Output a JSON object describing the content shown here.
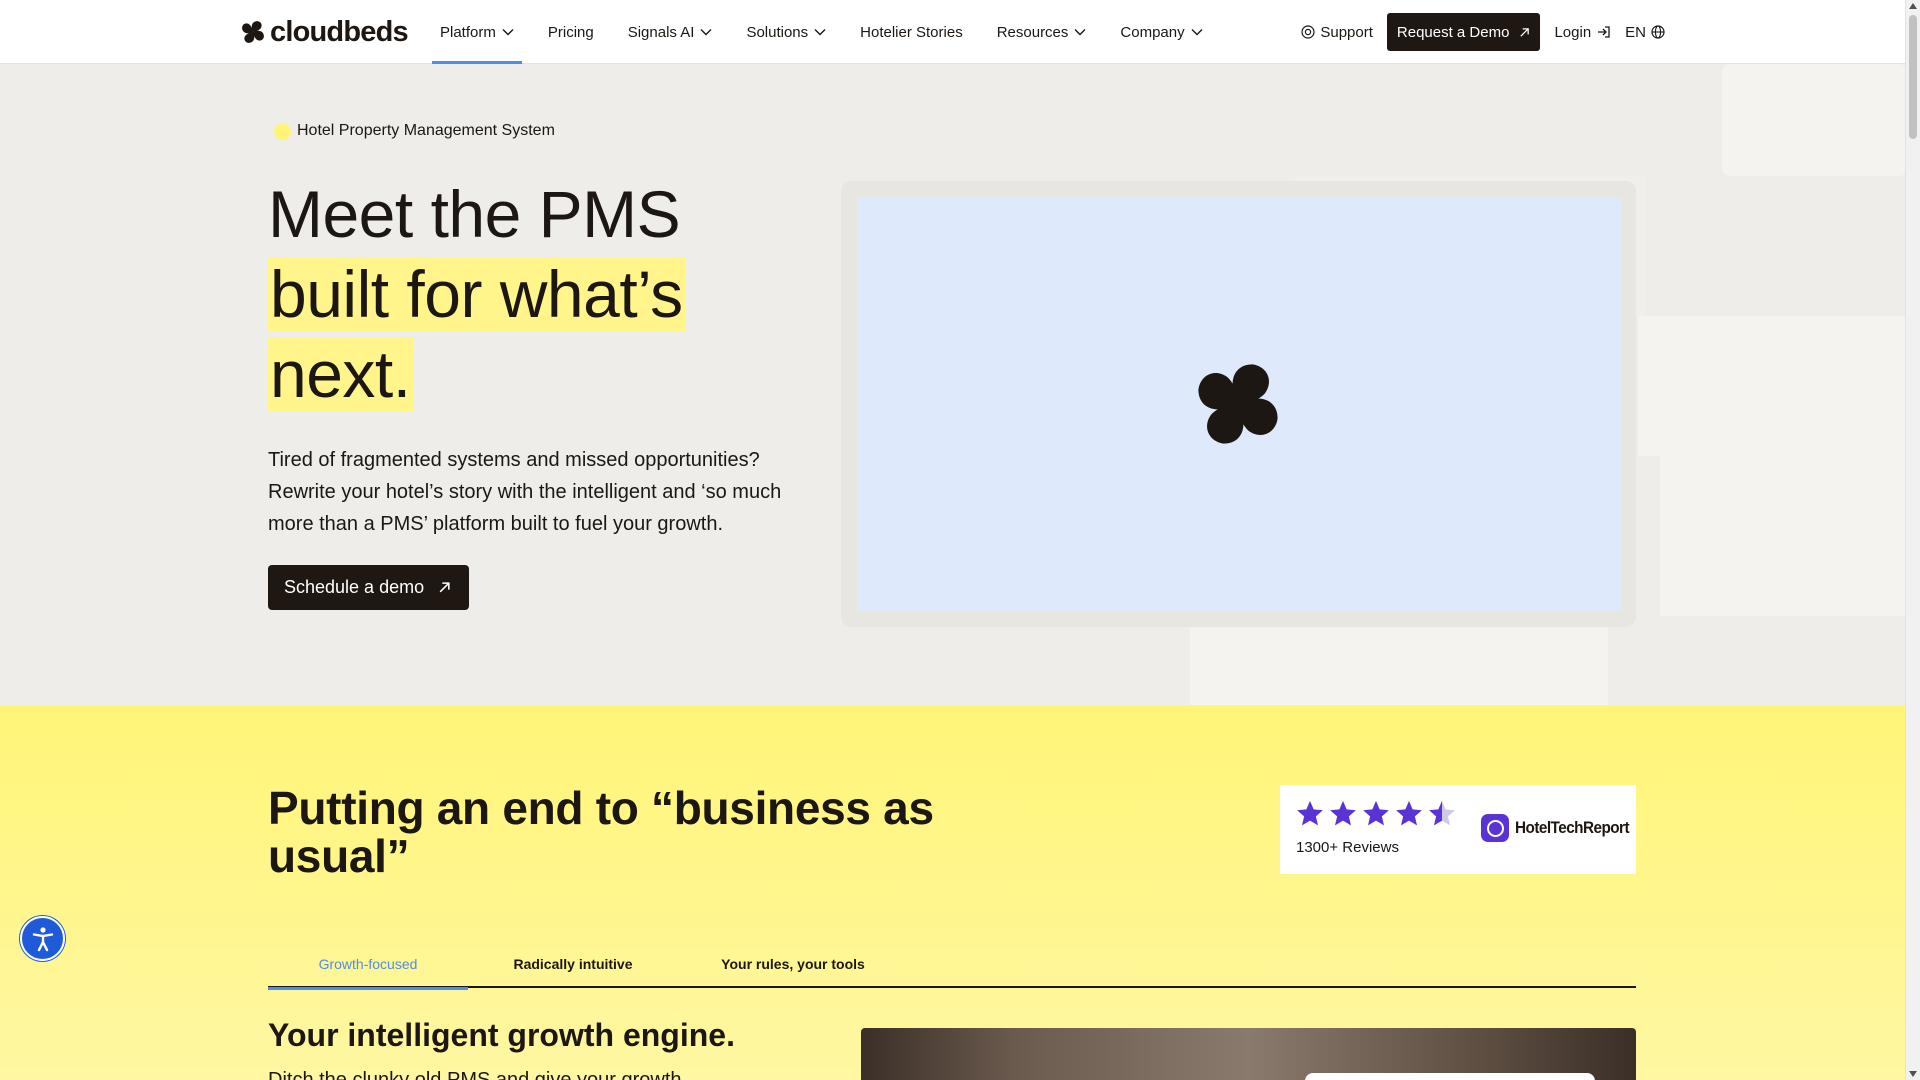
{
  "brand": {
    "name": "cloudbeds",
    "logo_icon": "cloudbeds-logo-icon"
  },
  "nav": {
    "items": [
      {
        "label": "Platform",
        "has_dropdown": true,
        "active": true
      },
      {
        "label": "Pricing",
        "has_dropdown": false
      },
      {
        "label": "Signals AI",
        "has_dropdown": true
      },
      {
        "label": "Solutions",
        "has_dropdown": true
      },
      {
        "label": "Hotelier Stories",
        "has_dropdown": false
      },
      {
        "label": "Resources",
        "has_dropdown": true
      },
      {
        "label": "Company",
        "has_dropdown": true
      }
    ],
    "support_label": "Support",
    "demo_label": "Request a Demo",
    "login_label": "Login",
    "language_label": "EN"
  },
  "hero": {
    "eyebrow": "Hotel Property Management System",
    "headline_line1": "Meet the PMS",
    "headline_line2": "built for what’s",
    "headline_line3": "next.",
    "body": "Tired of fragmented systems and missed opportunities? Rewrite your hotel’s story with the intelligent and ‘so much more than a PMS’ platform built to fuel your growth.",
    "cta_label": "Schedule a demo"
  },
  "section": {
    "title": "Putting an end to “business as usual”",
    "rating": {
      "stars": 4.5,
      "reviews_label": "1300+ Reviews",
      "source": "HotelTechReport"
    },
    "tabs": [
      {
        "label": "Growth-focused",
        "active": true
      },
      {
        "label": "Radically intuitive",
        "active": false
      },
      {
        "label": "Your rules, your tools",
        "active": false
      }
    ],
    "subtitle": "Your intelligent growth engine.",
    "subbody": "Ditch the clunky old PMS and give your growth"
  },
  "colors": {
    "accent": "#4e8fe6",
    "dark": "#1f1711",
    "highlight": "#fff58a",
    "section_bg": "#fff578",
    "star": "#5a33d6",
    "a11y": "#1f5bd8"
  }
}
